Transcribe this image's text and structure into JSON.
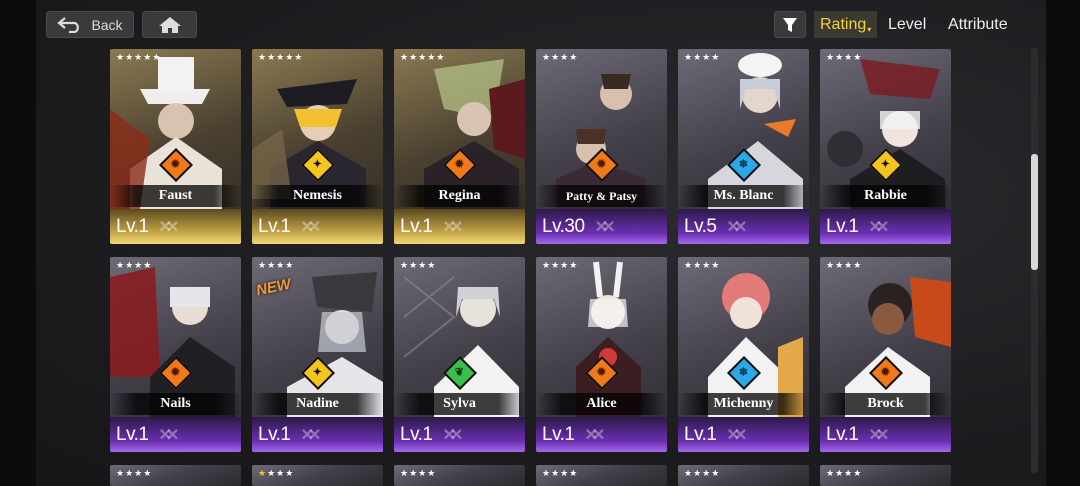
{
  "nav": {
    "back_label": "Back",
    "back_icon": "back-arrow-icon",
    "home_icon": "home-icon"
  },
  "sort": {
    "filter_icon": "filter-icon",
    "tabs": [
      {
        "label": "Rating",
        "active": true
      },
      {
        "label": "Level",
        "active": false
      },
      {
        "label": "Attribute",
        "active": false
      }
    ]
  },
  "colors": {
    "accent": "#f4d23a",
    "fire": "#f07a1a",
    "light": "#f4c51c",
    "ice": "#2aa8e8",
    "nature": "#3bbf4a",
    "gold_rarity": "#c9a94a",
    "purple_rarity": "#6c2fb3"
  },
  "cards": [
    {
      "name": "Faust",
      "stars": "★★★★★",
      "element": "fire",
      "level": "Lv.1",
      "rarity": "gold"
    },
    {
      "name": "Nemesis",
      "stars": "★★★★★",
      "element": "light",
      "level": "Lv.1",
      "rarity": "gold"
    },
    {
      "name": "Regina",
      "stars": "★★★★★",
      "element": "fire",
      "level": "Lv.1",
      "rarity": "gold"
    },
    {
      "name": "Patty & Patsy",
      "stars": "★★★★",
      "element": "fire",
      "level": "Lv.30",
      "rarity": "purple"
    },
    {
      "name": "Ms. Blanc",
      "stars": "★★★★",
      "element": "ice",
      "level": "Lv.5",
      "rarity": "purple"
    },
    {
      "name": "Rabbie",
      "stars": "★★★★",
      "element": "light",
      "level": "Lv.1",
      "rarity": "purple"
    },
    {
      "name": "Nails",
      "stars": "★★★★",
      "element": "fire",
      "level": "Lv.1",
      "rarity": "purple"
    },
    {
      "name": "Nadine",
      "stars": "★★★★",
      "element": "light",
      "level": "Lv.1",
      "rarity": "purple",
      "badge": "NEW"
    },
    {
      "name": "Sylva",
      "stars": "★★★★",
      "element": "nature",
      "level": "Lv.1",
      "rarity": "purple"
    },
    {
      "name": "Alice",
      "stars": "★★★★",
      "element": "fire",
      "level": "Lv.1",
      "rarity": "purple"
    },
    {
      "name": "Michenny",
      "stars": "★★★★",
      "element": "ice",
      "level": "Lv.1",
      "rarity": "purple"
    },
    {
      "name": "Brock",
      "stars": "★★★★",
      "element": "fire",
      "level": "Lv.1",
      "rarity": "purple"
    }
  ],
  "partial_row_stars": [
    "★★★★",
    "★★★★",
    "★★★★",
    "★★★★",
    "★★★★",
    "★★★★"
  ]
}
